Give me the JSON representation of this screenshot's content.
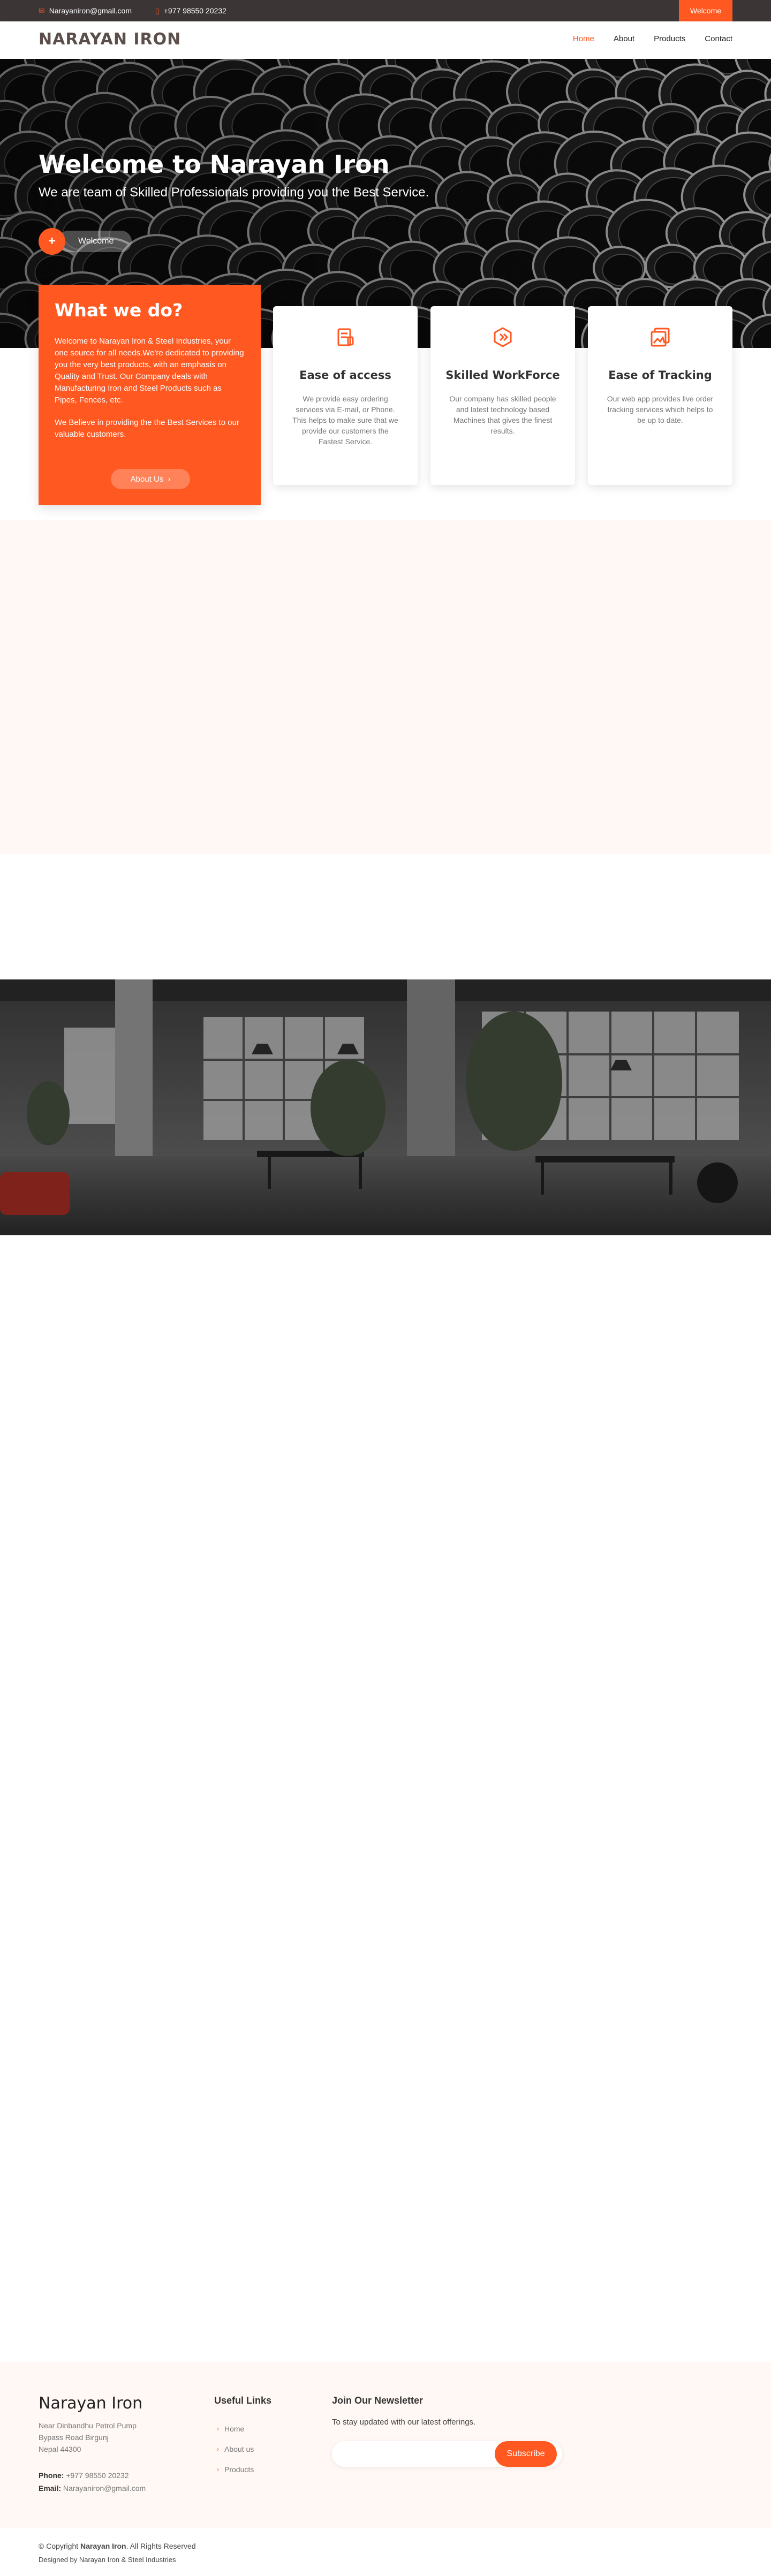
{
  "topbar": {
    "email": "Narayaniron@gmail.com",
    "phone": "+977 98550 20232",
    "welcome_button": "Welcome"
  },
  "header": {
    "logo": "NARAYAN IRON",
    "nav": [
      "Home",
      "About",
      "Products",
      "Contact"
    ],
    "active_nav": "Home"
  },
  "hero": {
    "title": "Welcome to Narayan Iron",
    "subtitle": "We are team of Skilled Professionals providing you the Best Service.",
    "cta_icon": "+",
    "cta_label": "Welcome"
  },
  "what_we_do": {
    "heading": "What we do?",
    "paragraph_1": "Welcome to Narayan Iron & Steel Industries, your one source for all needs.We're dedicated to providing you the very best products, with an emphasis on Quality and Trust. Our Company deals with Manufacturing Iron and Steel Products such as Pipes, Fences, etc.",
    "paragraph_2": "We Believe in providing the the Best Services to our valuable customers.",
    "button": "About Us",
    "button_icon": "›"
  },
  "features": [
    {
      "icon": "receipt-icon",
      "title": "Ease of access",
      "text": "We provide easy ordering services via E-mail, or Phone. This helps to make sure that we provide our customers the Fastest Service."
    },
    {
      "icon": "hexagon-code-icon",
      "title": "Skilled WorkForce",
      "text": "Our company has skilled people and latest technology based Machines that gives the finest results."
    },
    {
      "icon": "image-tracking-icon",
      "title": "Ease of Tracking",
      "text": "Our web app provides live order tracking services which helps to be up to date."
    }
  ],
  "footer": {
    "brand": "Narayan Iron",
    "address_line_1": "Near Dinbandhu Petrol Pump",
    "address_line_2": "Bypass Road Birgunj",
    "address_line_3": "Nepal 44300",
    "phone_label": "Phone:",
    "phone": "+977 98550 20232",
    "email_label": "Email:",
    "email": "Narayaniron@gmail.com",
    "links_heading": "Useful Links",
    "links": [
      "Home",
      "About us",
      "Products"
    ],
    "newsletter_heading": "Join Our Newsletter",
    "newsletter_text": "To stay updated with our latest offerings.",
    "newsletter_placeholder": "",
    "subscribe": "Subscribe"
  },
  "copyright": {
    "prefix": "© Copyright",
    "brand": "Narayan Iron",
    "suffix": ". All Rights Reserved",
    "designed_by": "Designed by Narayan Iron & Steel Industries"
  },
  "colors": {
    "accent": "#ff5821",
    "topbar": "#3b3536",
    "light_band": "#fff8f4"
  }
}
